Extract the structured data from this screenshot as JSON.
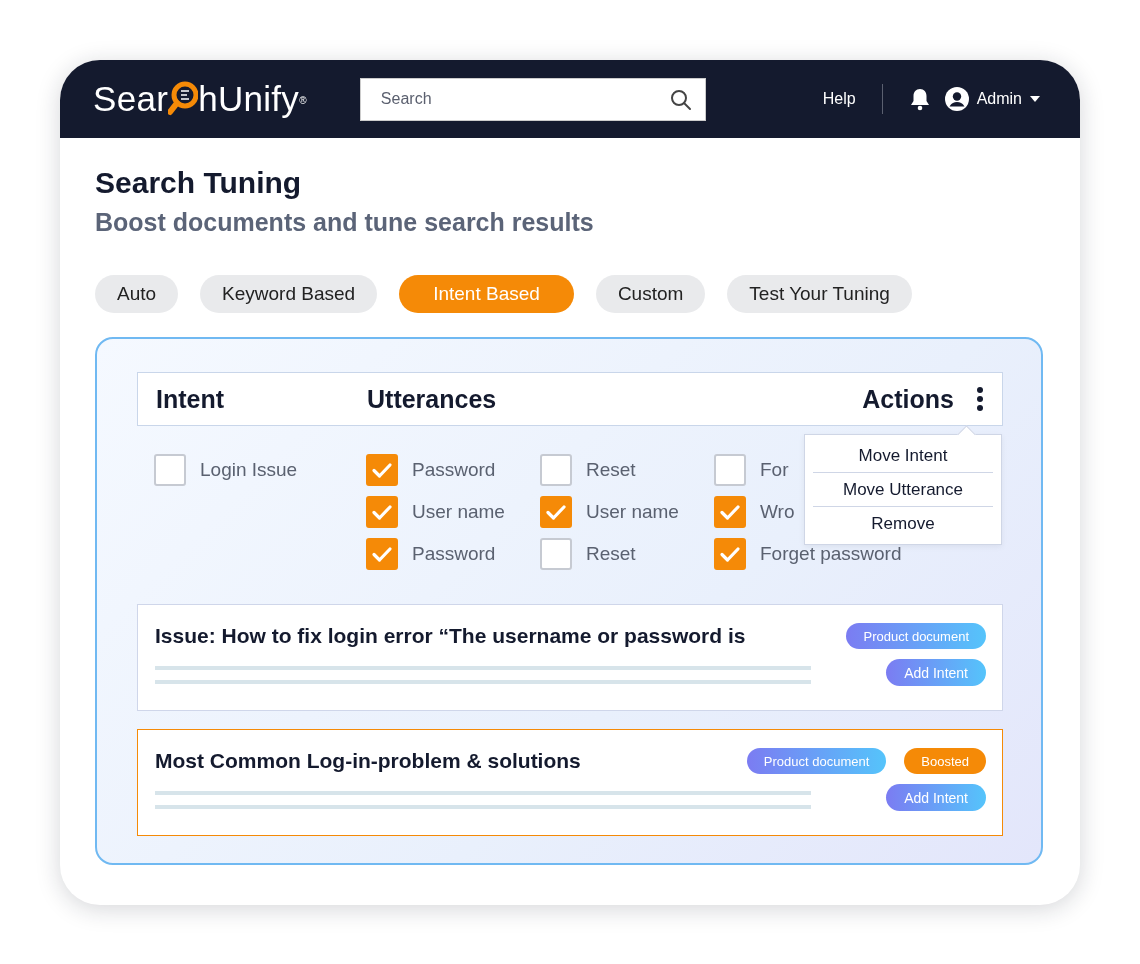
{
  "header": {
    "logo": {
      "before": "Sear",
      "after": "hUnify",
      "mark": "®"
    },
    "search": {
      "placeholder": "Search"
    },
    "help": "Help",
    "user": "Admin"
  },
  "page": {
    "title": "Search Tuning",
    "subtitle": "Boost documents and tune search results"
  },
  "tabs": [
    {
      "label": "Auto",
      "selected": false
    },
    {
      "label": "Keyword Based",
      "selected": false
    },
    {
      "label": "Intent Based",
      "selected": true
    },
    {
      "label": "Custom",
      "selected": false
    },
    {
      "label": "Test Your Tuning",
      "selected": false
    }
  ],
  "table": {
    "columns": [
      "Intent",
      "Utterances",
      "Actions"
    ],
    "intents": [
      {
        "label": "Login Issue",
        "checked": false,
        "utterances": [
          [
            {
              "label": "Password",
              "checked": true
            },
            {
              "label": "Reset",
              "checked": false
            },
            {
              "label": "For",
              "checked": false
            }
          ],
          [
            {
              "label": "User name",
              "checked": true
            },
            {
              "label": "User name",
              "checked": true
            },
            {
              "label": "Wro",
              "checked": true
            }
          ],
          [
            {
              "label": "Password",
              "checked": true
            },
            {
              "label": "Reset",
              "checked": false
            },
            {
              "label": "Forget password",
              "checked": true
            }
          ]
        ]
      }
    ]
  },
  "menu": {
    "items": [
      "Move Intent",
      "Move Utterance",
      "Remove"
    ]
  },
  "documents": [
    {
      "title": "Issue: How to fix login error “The username or password is",
      "highlighted": false,
      "tags": [
        {
          "label": "Product document",
          "kind": "type"
        }
      ],
      "action": "Add Intent"
    },
    {
      "title": "Most Common Log-in-problem & solutions",
      "highlighted": true,
      "tags": [
        {
          "label": "Product document",
          "kind": "type"
        },
        {
          "label": "Boosted",
          "kind": "status"
        }
      ],
      "action": "Add Intent"
    }
  ]
}
